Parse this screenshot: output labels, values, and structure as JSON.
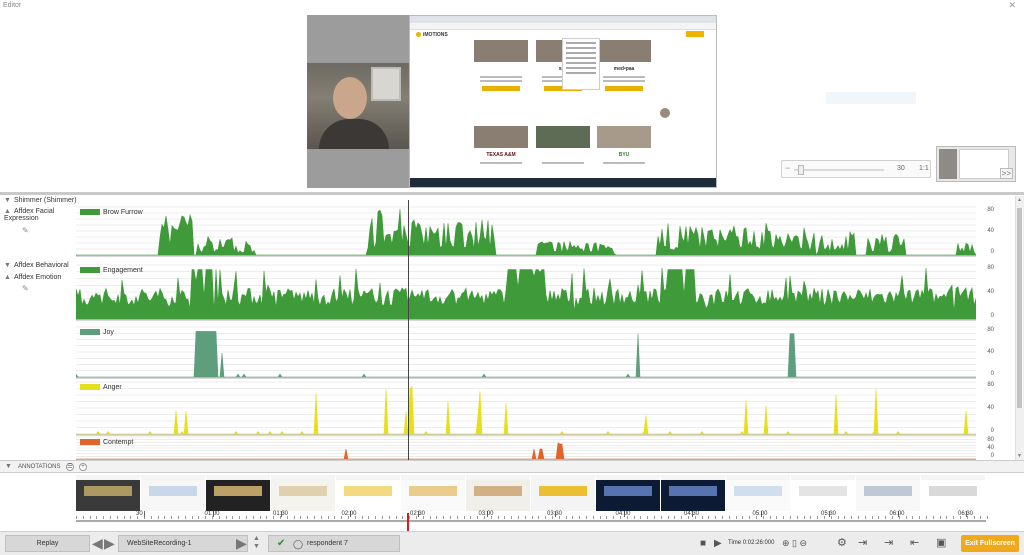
{
  "window": {
    "title": "Editor",
    "close_glyph": "✕"
  },
  "media": {
    "webpage": {
      "logo": "iMOTIONS",
      "cards_row1_logos": [
        "",
        "spe",
        "med•paa"
      ],
      "cards_row2_logos": [
        "TEXAS A&M",
        "",
        "BYU"
      ]
    },
    "slider": {
      "minus": "−",
      "value": "30",
      "ratio": "1:1"
    },
    "faint_button": "",
    "thumb_arrow": ">>"
  },
  "tree": {
    "shimmer": "Shimmer (Shimmer)",
    "affdex_facial": "Affdex Facial Expression",
    "affdex_behavioral": "Affdex Behavioral",
    "affdex_emotion": "Affdex Emotion"
  },
  "chart_data": [
    {
      "type": "area",
      "name": "Brow Furrow",
      "color": "#3f9a3a",
      "ylim": [
        0,
        100
      ],
      "yticks": [
        "80",
        "40",
        "0"
      ]
    },
    {
      "type": "area",
      "name": "Engagement",
      "color": "#3f9a3a",
      "ylim": [
        0,
        100
      ],
      "yticks": [
        "80",
        "40",
        "0"
      ]
    },
    {
      "type": "area",
      "name": "Joy",
      "color": "#5e9e7c",
      "ylim": [
        0,
        100
      ],
      "yticks": [
        "80",
        "40",
        "0"
      ]
    },
    {
      "type": "area",
      "name": "Anger",
      "color": "#e6e01a",
      "ylim": [
        0,
        100
      ],
      "yticks": [
        "80",
        "40",
        "0"
      ]
    },
    {
      "type": "area",
      "name": "Contempt",
      "color": "#e0642b",
      "ylim": [
        0,
        100
      ],
      "yticks": [
        "80",
        "40",
        "0"
      ]
    }
  ],
  "annotations": {
    "label": "ANNOTATIONS",
    "list_icon": "☰",
    "add_icon": "+"
  },
  "timeline": {
    "labels": [
      "30",
      "01:00",
      "01:30",
      "02:00",
      "02:30",
      "03:00",
      "03:30",
      "04:00",
      "04:30",
      "05:00",
      "05:30",
      "06:00",
      "06:30"
    ]
  },
  "bottombar": {
    "replay": "Replay",
    "recording": "WebSiteRecording-1",
    "respondent": "respondent 7",
    "time": "Time 0:02:26:000",
    "exit": "Exit Fullscreen"
  }
}
